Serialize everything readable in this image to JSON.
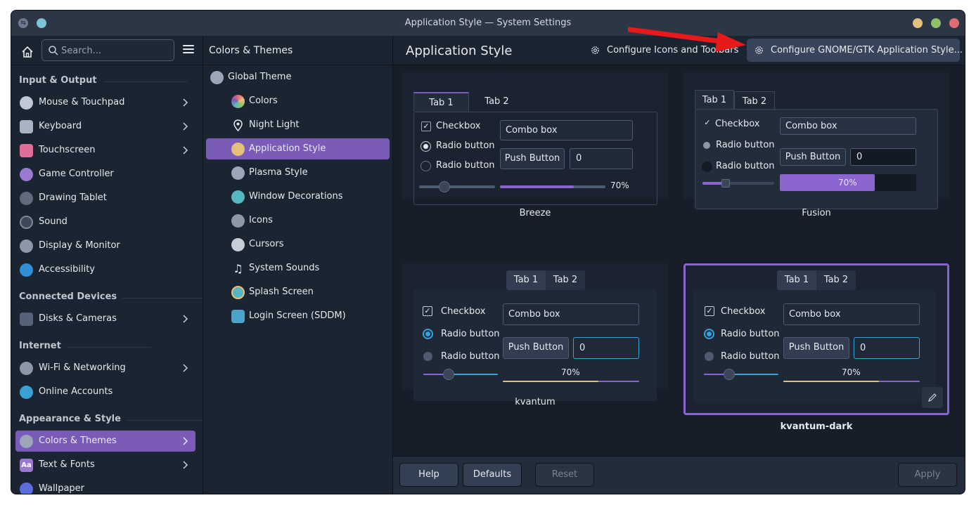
{
  "window": {
    "title": "Application Style — System Settings"
  },
  "sidebar": {
    "search_placeholder": "Search...",
    "sections": [
      {
        "title": "Input & Output"
      },
      {
        "title": "Connected Devices"
      },
      {
        "title": "Internet"
      },
      {
        "title": "Appearance & Style"
      }
    ],
    "items": [
      {
        "label": "Mouse & Touchpad",
        "icon": "mouse-icon",
        "chevron": true
      },
      {
        "label": "Keyboard",
        "icon": "keyboard-icon",
        "chevron": true
      },
      {
        "label": "Touchscreen",
        "icon": "touchscreen-icon",
        "chevron": true
      },
      {
        "label": "Game Controller",
        "icon": "gamepad-icon",
        "chevron": false
      },
      {
        "label": "Drawing Tablet",
        "icon": "tablet-icon",
        "chevron": false
      },
      {
        "label": "Sound",
        "icon": "sound-icon",
        "chevron": false
      },
      {
        "label": "Display & Monitor",
        "icon": "display-icon",
        "chevron": false
      },
      {
        "label": "Accessibility",
        "icon": "accessibility-icon",
        "chevron": false
      },
      {
        "label": "Disks & Cameras",
        "icon": "disks-icon",
        "chevron": true
      },
      {
        "label": "Wi-Fi & Networking",
        "icon": "network-icon",
        "chevron": true
      },
      {
        "label": "Online Accounts",
        "icon": "accounts-icon",
        "chevron": false
      },
      {
        "label": "Colors & Themes",
        "icon": "themes-icon",
        "chevron": true,
        "active": true
      },
      {
        "label": "Text & Fonts",
        "icon": "fonts-icon",
        "chevron": true
      },
      {
        "label": "Wallpaper",
        "icon": "wallpaper-icon",
        "chevron": false
      }
    ]
  },
  "middle": {
    "title": "Colors & Themes",
    "items": [
      {
        "label": "Global Theme"
      },
      {
        "label": "Colors"
      },
      {
        "label": "Night Light"
      },
      {
        "label": "Application Style",
        "active": true
      },
      {
        "label": "Plasma Style"
      },
      {
        "label": "Window Decorations"
      },
      {
        "label": "Icons"
      },
      {
        "label": "Cursors"
      },
      {
        "label": "System Sounds"
      },
      {
        "label": "Splash Screen"
      },
      {
        "label": "Login Screen (SDDM)"
      }
    ]
  },
  "main": {
    "title": "Application Style",
    "configure_icons": "Configure Icons and Toolbars",
    "configure_gtk": "Configure GNOME/GTK Application Style...",
    "styles": [
      {
        "name": "Breeze"
      },
      {
        "name": "Fusion"
      },
      {
        "name": "kvantum"
      },
      {
        "name": "kvantum-dark",
        "selected": true
      }
    ],
    "preview": {
      "tab1": "Tab 1",
      "tab2": "Tab 2",
      "checkbox": "Checkbox",
      "radio": "Radio button",
      "combo": "Combo box",
      "push": "Push Button",
      "spin_value": "0",
      "progress": 0.7,
      "progress_label": "70%"
    }
  },
  "footer": {
    "help": "Help",
    "defaults": "Defaults",
    "reset": "Reset",
    "apply": "Apply"
  },
  "colors": {
    "accent": "#7a5cb8",
    "selection_border": "#8a65cf",
    "annotation_arrow": "#e8191b"
  }
}
